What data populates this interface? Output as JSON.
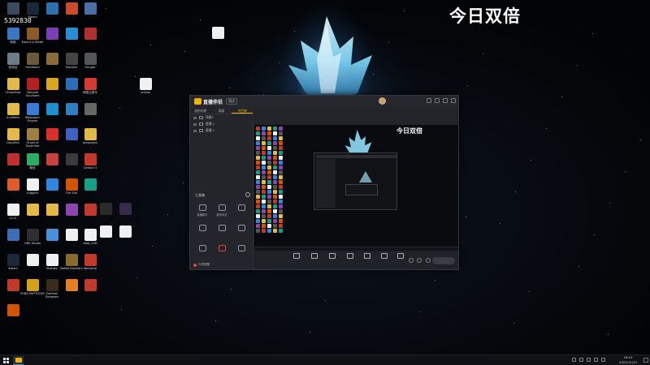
{
  "overlay_text": "今日双倍",
  "counter_text": "5392830",
  "desktop_icons": [
    {
      "label": "",
      "icon": "app-icon",
      "color": "#3b4a5c"
    },
    {
      "label": "Steam",
      "icon": "steam-icon",
      "color": "#1b2838"
    },
    {
      "label": "",
      "icon": "app-icon",
      "color": "#2f6fb0"
    },
    {
      "label": "",
      "icon": "app-icon",
      "color": "#c94b2c"
    },
    {
      "label": "",
      "icon": "app-icon",
      "color": "#4a6fa5"
    },
    {
      "label": "网络",
      "icon": "network-icon",
      "color": "#3a77c2"
    },
    {
      "label": "Mount & Blade",
      "icon": "game-icon",
      "color": "#8b5a2b"
    },
    {
      "label": "",
      "icon": "app-icon",
      "color": "#7a3fb5"
    },
    {
      "label": "",
      "icon": "app-icon",
      "color": "#2c8bd6"
    },
    {
      "label": "",
      "icon": "app-icon",
      "color": "#b03030"
    },
    {
      "label": "回收站",
      "icon": "recycle-bin-icon",
      "color": "#6d7a88"
    },
    {
      "label": "RimWorld",
      "icon": "game-icon",
      "color": "#6b5a3a"
    },
    {
      "label": "",
      "icon": "app-icon",
      "color": "#8a6b3a"
    },
    {
      "label": "Monster",
      "icon": "game-icon",
      "color": "#444"
    },
    {
      "label": "Hunger",
      "icon": "game-icon",
      "color": "#555"
    },
    {
      "label": "ChoseEngi",
      "icon": "folder-icon",
      "color": "#e3b94a"
    },
    {
      "label": "Vampire Survivors",
      "icon": "game-icon",
      "color": "#b22222"
    },
    {
      "label": "",
      "icon": "app-icon",
      "color": "#d9a520"
    },
    {
      "label": "",
      "icon": "app-icon",
      "color": "#2a6fb8"
    },
    {
      "label": "网易云音乐",
      "icon": "music-icon",
      "color": "#d43c33"
    },
    {
      "label": "XunMeet",
      "icon": "folder-icon",
      "color": "#e3b94a"
    },
    {
      "label": "Wallpaper Engine",
      "icon": "wallpaper-icon",
      "color": "#3a7bd5"
    },
    {
      "label": "",
      "icon": "app-icon",
      "color": "#1f8fd0"
    },
    {
      "label": "",
      "icon": "app-icon",
      "color": "#2d7fc1"
    },
    {
      "label": "",
      "icon": "app-icon",
      "color": "#666"
    },
    {
      "label": "GongFah",
      "icon": "folder-icon",
      "color": "#e3b94a"
    },
    {
      "label": "Ghost of Tsushima",
      "icon": "game-icon",
      "color": "#a08040"
    },
    {
      "label": "",
      "icon": "app-icon",
      "color": "#d9302c"
    },
    {
      "label": "",
      "icon": "app-icon",
      "color": "#4060c0"
    },
    {
      "label": "langorgen",
      "icon": "folder-icon",
      "color": "#e3b94a"
    },
    {
      "label": "",
      "icon": "app-icon",
      "color": "#c03030"
    },
    {
      "label": "微信",
      "icon": "wechat-icon",
      "color": "#2aae67"
    },
    {
      "label": "",
      "icon": "app-icon",
      "color": "#c94040"
    },
    {
      "label": "",
      "icon": "app-icon",
      "color": "#3a3a3a"
    },
    {
      "label": "Carbon 3",
      "icon": "app-icon",
      "color": "#c0392b"
    },
    {
      "label": "",
      "icon": "app-icon",
      "color": "#e05a2a"
    },
    {
      "label": "triggers",
      "icon": "file-icon",
      "color": "#f0f0f0"
    },
    {
      "label": "",
      "icon": "app-icon",
      "color": "#2e86de"
    },
    {
      "label": "The Sun",
      "icon": "app-icon",
      "color": "#d35400"
    },
    {
      "label": "",
      "icon": "app-icon",
      "color": "#16a085"
    },
    {
      "label": "1111",
      "icon": "file-icon",
      "color": "#f0f0f0"
    },
    {
      "label": "",
      "icon": "folder-icon",
      "color": "#e3b94a"
    },
    {
      "label": "",
      "icon": "folder-icon",
      "color": "#e3b94a"
    },
    {
      "label": "",
      "icon": "app-icon",
      "color": "#8e44ad"
    },
    {
      "label": "",
      "icon": "app-icon",
      "color": "#c0392b"
    },
    {
      "label": "",
      "icon": "app-icon",
      "color": "#3d6eb5"
    },
    {
      "label": "OBS Studio",
      "icon": "obs-icon",
      "color": "#302e31"
    },
    {
      "label": "",
      "icon": "app-icon",
      "color": "#4a90d9"
    },
    {
      "label": "",
      "icon": "file-icon",
      "color": "#f0f0f0"
    },
    {
      "label": "data_14D",
      "icon": "file-icon",
      "color": "#f0f0f0"
    },
    {
      "label": "Steam",
      "icon": "steam-icon",
      "color": "#1b2838"
    },
    {
      "label": "",
      "icon": "file-icon",
      "color": "#f0f0f0"
    },
    {
      "label": "Brotato",
      "icon": "file-icon",
      "color": "#f0f0f0"
    },
    {
      "label": "Battle Brothers",
      "icon": "game-icon",
      "color": "#8b6b2b"
    },
    {
      "label": "WeGame",
      "icon": "game-icon",
      "color": "#c0392b"
    },
    {
      "label": "",
      "icon": "app-icon",
      "color": "#c0392b"
    },
    {
      "label": "PUBG BATTLEGR",
      "icon": "game-icon",
      "color": "#d4a017"
    },
    {
      "label": "Darkest Dungeon",
      "icon": "game-icon",
      "color": "#3a2a1a"
    },
    {
      "label": "",
      "icon": "app-icon",
      "color": "#e67e22"
    },
    {
      "label": "",
      "icon": "app-icon",
      "color": "#c0392b"
    },
    {
      "label": "",
      "icon": "app-icon",
      "color": "#d35400"
    }
  ],
  "scattered_icons": [
    {
      "label": "",
      "icon": "file-icon",
      "color": "#f0f0f0"
    },
    {
      "label": "scripts",
      "icon": "file-icon",
      "color": "#f0f0f0"
    },
    {
      "label": "",
      "icon": "app-icon",
      "color": "#2b2b2b"
    },
    {
      "label": "",
      "icon": "app-icon",
      "color": "#3a2a4a"
    },
    {
      "label": "",
      "icon": "file-icon",
      "color": "#f0f0f0"
    },
    {
      "label": "",
      "icon": "file-icon",
      "color": "#f0f0f0"
    }
  ],
  "app": {
    "name": "直播伴侣",
    "version_badge": "测试",
    "tabs": [
      "我的场景",
      "高级",
      "节目单"
    ],
    "scenes": [
      "场景1",
      "直播 1",
      "直播 1"
    ],
    "toolbox_title": "工具箱",
    "tools": [
      "直播助手",
      "更多玩法",
      "",
      "",
      "",
      "",
      "",
      "",
      ""
    ],
    "hint": "礼物提醒",
    "room_title": "",
    "edit_label": "",
    "category": "",
    "tags": [
      "",
      "",
      "",
      ""
    ],
    "preview_overlay": "今日双倍",
    "controls": [
      "",
      "",
      "",
      "",
      "",
      "",
      ""
    ],
    "golive_label": ""
  },
  "taskbar": {
    "clock_time": "16:10",
    "clock_date": "2022/11/23"
  }
}
